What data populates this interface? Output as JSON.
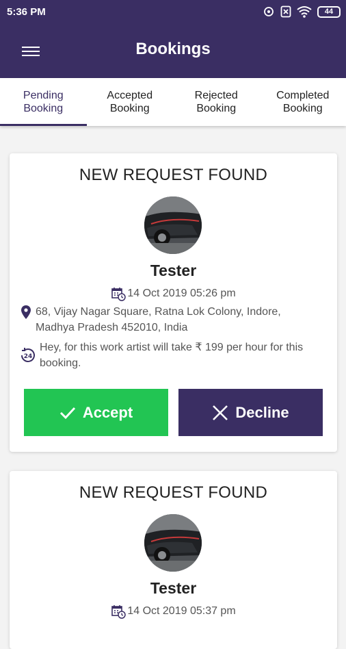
{
  "status_bar": {
    "time": "5:36 PM",
    "battery": "44"
  },
  "header": {
    "title": "Bookings",
    "menu_icon": "hamburger-menu-icon"
  },
  "tabs": [
    {
      "label": "Pending\nBooking",
      "line1": "Pending",
      "line2": "Booking",
      "active": true
    },
    {
      "label": "Accepted\nBooking",
      "line1": "Accepted",
      "line2": "Booking",
      "active": false
    },
    {
      "label": "Rejected\nBooking",
      "line1": "Rejected",
      "line2": "Booking",
      "active": false
    },
    {
      "label": "Completed\nBooking",
      "line1": "Completed",
      "line2": "Booking",
      "active": false
    }
  ],
  "bookings": [
    {
      "heading": "NEW REQUEST FOUND",
      "name": "Tester",
      "datetime": "14 Oct 2019 05:26 pm",
      "address": "68, Vijay Nagar Square, Ratna Lok Colony, Indore, Madhya Pradesh 452010, India",
      "info": "Hey, for this work artist will take ₹ 199 per hour for this booking.",
      "accept_label": "Accept",
      "decline_label": "Decline"
    },
    {
      "heading": "NEW REQUEST FOUND",
      "name": "Tester",
      "datetime": "14 Oct 2019 05:37 pm"
    }
  ],
  "colors": {
    "primary": "#3a2e63",
    "accept": "#22c553",
    "background": "#f3f3f3"
  }
}
